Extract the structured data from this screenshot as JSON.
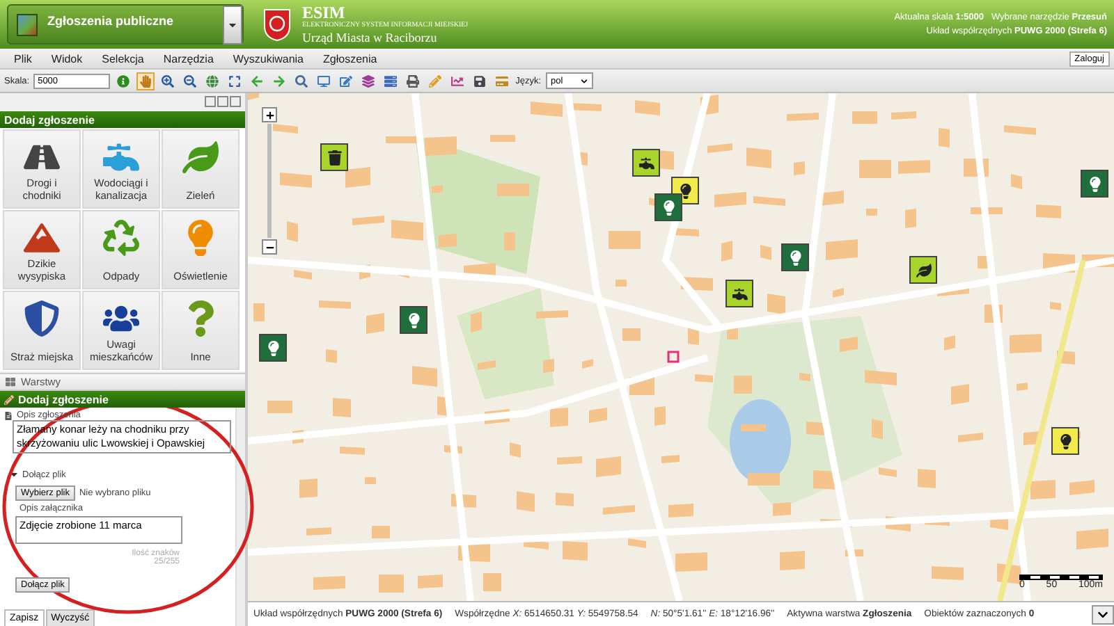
{
  "app_selector": {
    "title": "Zgłoszenia publiczne"
  },
  "header": {
    "logo_title": "ESIM",
    "logo_subtitle": "ELEKTRONICZNY SYSTEM INFORMACJI MIEJSKIEJ",
    "office": "Urząd Miasta w Raciborzu",
    "scale_info": "Aktualna skala **1:5000**   Wybrane narzędzie **Przesuń**",
    "crs_info": "Układ współrzędnych **PUWG 2000 (Strefa 6)**"
  },
  "menu": [
    "Plik",
    "Widok",
    "Selekcja",
    "Narzędzia",
    "Wyszukiwania",
    "Zgłoszenia"
  ],
  "login_button": "Zaloguj",
  "toolbar": {
    "scale_label": "Skala:",
    "scale_value": "5000",
    "language_label": "Język:",
    "language_value": "pol",
    "tools": [
      {
        "kind": "info",
        "selected": false
      },
      {
        "kind": "pan",
        "selected": true
      },
      {
        "kind": "zoom-in",
        "selected": false
      },
      {
        "kind": "zoom-out",
        "selected": false
      },
      {
        "kind": "globe",
        "selected": false
      },
      {
        "kind": "extent",
        "selected": false
      },
      {
        "kind": "back",
        "selected": false
      },
      {
        "kind": "forward",
        "selected": false
      },
      {
        "kind": "search",
        "selected": false
      },
      {
        "kind": "monitor",
        "selected": false
      },
      {
        "kind": "edit",
        "selected": false
      },
      {
        "kind": "layers",
        "selected": false
      },
      {
        "kind": "server",
        "selected": false
      },
      {
        "kind": "print",
        "selected": false
      },
      {
        "kind": "pencil",
        "selected": false
      },
      {
        "kind": "chart",
        "selected": false
      },
      {
        "kind": "save",
        "selected": false
      },
      {
        "kind": "card",
        "selected": false
      }
    ]
  },
  "categories_panel": {
    "title": "Dodaj zgłoszenie",
    "categories": [
      {
        "kind": "road",
        "label": "Drogi i chodniki"
      },
      {
        "kind": "water",
        "label": "Wodociągi i kanalizacja"
      },
      {
        "kind": "green",
        "label": "Zieleń"
      },
      {
        "kind": "dump",
        "label": "Dzikie wysypiska"
      },
      {
        "kind": "waste",
        "label": "Odpady"
      },
      {
        "kind": "light",
        "label": "Oświetlenie"
      },
      {
        "kind": "guard",
        "label": "Straż miejska"
      },
      {
        "kind": "residents",
        "label": "Uwagi mieszkańców"
      },
      {
        "kind": "other",
        "label": "Inne"
      }
    ]
  },
  "layers_bar": {
    "title": "Warstwy"
  },
  "report_form": {
    "title": "Dodaj zgłoszenie",
    "description_label": "Opis zgłoszenia",
    "description": "Złamany konar leży na chodniku przy skrzyżowaniu ulic Lwowskiej i Opawskiej",
    "attach_section": {
      "title": "Dołącz plik",
      "expanded": true
    },
    "choose_file_button": "Wybierz plik",
    "no_file": "Nie wybrano pliku",
    "attachment_label": "Opis załącznika",
    "attachment_description": "Zdjęcie zrobione 11 marca",
    "char_count_label": "Ilość znaków",
    "char_count": "25/255",
    "attach_button": "Dołącz plik",
    "tabs": [
      {
        "label": "Zapisz",
        "selected": true
      },
      {
        "label": "Wyczyść",
        "selected": false
      }
    ]
  },
  "map": {
    "markers": [
      {
        "kind": "waste",
        "color": "#a8d42c"
      },
      {
        "kind": "water",
        "color": "#a8d42c"
      },
      {
        "kind": "light",
        "color": "#f0ea4a"
      },
      {
        "kind": "light",
        "color": "#1f6e3c"
      },
      {
        "kind": "light",
        "color": "#1f6e3c"
      },
      {
        "kind": "water",
        "color": "#a8d42c"
      },
      {
        "kind": "green",
        "color": "#a8d42c"
      },
      {
        "kind": "light",
        "color": "#1f6e3c"
      },
      {
        "kind": "light",
        "color": "#1f6e3c"
      },
      {
        "kind": "light",
        "color": "#1f6e3c"
      },
      {
        "kind": "light",
        "color": "#f0ea4a"
      }
    ],
    "scale_bar": [
      "0",
      "50",
      "100m"
    ]
  },
  "status_bar": [
    "Układ współrzędnych **PUWG 2000 (Strefa 6)**",
    "Współrzędne *X:* 6514650.31 *Y:* 5549758.54",
    "*N:* 50°5'1.61'' *E:* 18°12'16.96''",
    "Aktywna warstwa **Zgłoszenia**",
    "Obiektów zaznaczonych **0**"
  ]
}
